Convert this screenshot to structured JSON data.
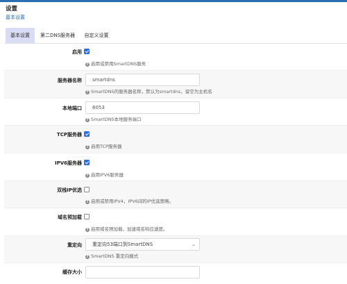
{
  "page": {
    "title": "设置",
    "breadcrumb": "基本设置"
  },
  "tabs": [
    {
      "label": "基本设置",
      "active": true
    },
    {
      "label": "第二DNS服务器",
      "active": false
    },
    {
      "label": "自定义设置",
      "active": false
    }
  ],
  "form": {
    "enable": {
      "label": "启用",
      "checked": true,
      "help": "启用或禁用SmartDNS服务"
    },
    "server_name": {
      "label": "服务器名称",
      "value": "smartdns",
      "help": "SmartDNS的服务器名称，默认为smartdns，留空为主机名"
    },
    "local_port": {
      "label": "本地端口",
      "value": "6053",
      "help": "SmartDNS本地服务端口"
    },
    "tcp_server": {
      "label": "TCP服务器",
      "checked": true,
      "help": "启用TCP服务器"
    },
    "ipv6_server": {
      "label": "IPV6服务器",
      "checked": true,
      "help": "启用IPV6服务器"
    },
    "dualstack": {
      "label": "双栈IP优选",
      "checked": false,
      "help": "启用或禁用IPV4，IPV6间的IP优选策略。"
    },
    "prefetch": {
      "label": "域名预加载",
      "checked": false,
      "help": "启用域名预加载，加速域名响应速度。"
    },
    "redirect": {
      "label": "重定向",
      "selected": "重定向53端口到SmartDNS",
      "help": "SmartDNS 重定向模式"
    },
    "cache_size": {
      "label": "缓存大小",
      "value": ""
    }
  },
  "icons": {
    "help": "help-circle-icon",
    "dropdown": "chevron-down-icon"
  },
  "colors": {
    "accent": "#2f6fdb",
    "active_tab": "#d9dcf5",
    "link": "#2f6fb3"
  }
}
